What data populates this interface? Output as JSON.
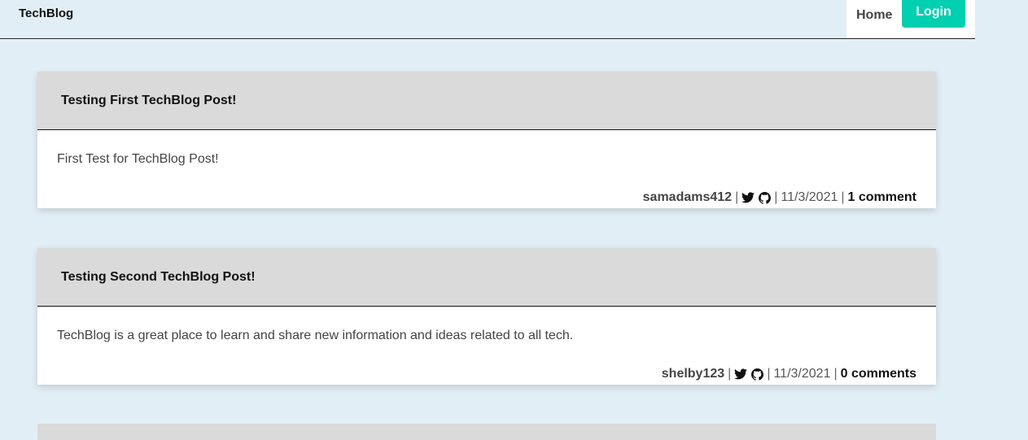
{
  "header": {
    "brand": "TechBlog",
    "nav": {
      "home_label": "Home",
      "login_label": "Login"
    }
  },
  "posts": [
    {
      "title": "Testing First TechBlog Post!",
      "content": "First Test for TechBlog Post!",
      "author": "samadams412",
      "date": "11/3/2021",
      "comments": "1 comment"
    },
    {
      "title": "Testing Second TechBlog Post!",
      "content": "TechBlog is a great place to learn and share new information and ideas related to all tech.",
      "author": "shelby123",
      "date": "11/3/2021",
      "comments": "0 comments"
    }
  ],
  "meta": {
    "separator": "|"
  },
  "icons": {
    "social": [
      "twitter-icon",
      "github-icon"
    ]
  },
  "colors": {
    "background": "#e2eef5",
    "accent": "#00cfb0",
    "card_header": "#dadada"
  }
}
